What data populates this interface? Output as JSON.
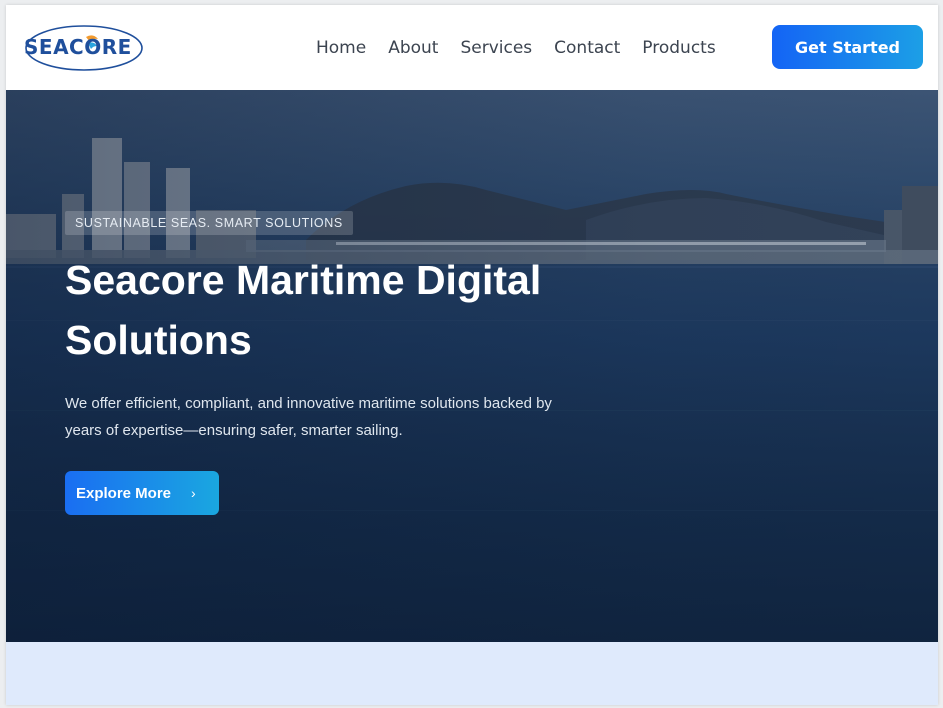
{
  "brand": {
    "name": "SEACORE",
    "color": "#1f4f9c",
    "accent": "#f29a2e"
  },
  "nav": {
    "links": [
      "Home",
      "About",
      "Services",
      "Contact",
      "Products"
    ],
    "cta_label": "Get Started"
  },
  "hero": {
    "tagline": "SUSTAINABLE SEAS. SMART SOLUTIONS",
    "title": "Seacore Maritime Digital Solutions",
    "subtitle": "We offer efficient, compliant, and innovative maritime solutions backed by years of expertise—ensuring safer, smarter sailing.",
    "button_label": "Explore More",
    "button_icon": "chevron-right-icon"
  },
  "colors": {
    "cta_gradient_start": "#1464f5",
    "cta_gradient_end": "#1c9fe6",
    "lower_section_bg": "#dfeafc"
  }
}
